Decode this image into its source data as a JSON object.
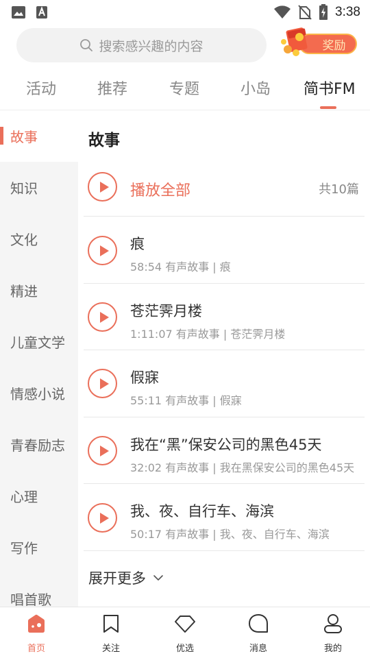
{
  "status_bar": {
    "time": "3:38",
    "left_icons": [
      "image-icon",
      "accessibility-icon"
    ],
    "right_icons": [
      "wifi-icon",
      "no-sim-icon",
      "battery-charging-icon"
    ]
  },
  "header": {
    "search_placeholder": "搜索感兴趣的内容",
    "reward_label": "奖励"
  },
  "tabs": [
    {
      "label": "活动",
      "active": false
    },
    {
      "label": "推荐",
      "active": false
    },
    {
      "label": "专题",
      "active": false
    },
    {
      "label": "小岛",
      "active": false
    },
    {
      "label": "简书FM",
      "active": true
    }
  ],
  "categories": [
    {
      "label": "故事",
      "active": true
    },
    {
      "label": "知识",
      "active": false
    },
    {
      "label": "文化",
      "active": false
    },
    {
      "label": "精进",
      "active": false
    },
    {
      "label": "儿童文学",
      "active": false
    },
    {
      "label": "情感小说",
      "active": false
    },
    {
      "label": "青春励志",
      "active": false
    },
    {
      "label": "心理",
      "active": false
    },
    {
      "label": "写作",
      "active": false
    },
    {
      "label": "唱首歌",
      "active": false
    }
  ],
  "content": {
    "section_title": "故事",
    "play_all_label": "播放全部",
    "play_all_count": "共10篇",
    "items": [
      {
        "title": "痕",
        "meta": "58:54  有声故事 | 痕"
      },
      {
        "title": "苍茫霁月楼",
        "meta": "1:11:07  有声故事 | 苍茫霁月楼"
      },
      {
        "title": "假寐",
        "meta": "55:11  有声故事 | 假寐"
      },
      {
        "title": "我在“黑”保安公司的黑色45天",
        "meta": "32:02  有声故事 | 我在黑保安公司的黑色45天"
      },
      {
        "title": "我、夜、自行车、海滨",
        "meta": "50:17  有声故事 | 我、夜、自行车、海滨"
      }
    ],
    "expand_label": "展开更多"
  },
  "bottom_nav": [
    {
      "label": "首页",
      "icon": "home-icon",
      "active": true
    },
    {
      "label": "关注",
      "icon": "bookmark-icon",
      "active": false
    },
    {
      "label": "优选",
      "icon": "diamond-icon",
      "active": false
    },
    {
      "label": "消息",
      "icon": "chat-bubble-icon",
      "active": false
    },
    {
      "label": "我的",
      "icon": "profile-icon",
      "active": false
    }
  ],
  "colors": {
    "accent": "#ea6f5a",
    "sidebar_bg": "#f5f5f5",
    "search_bg": "#f2f2f2"
  }
}
